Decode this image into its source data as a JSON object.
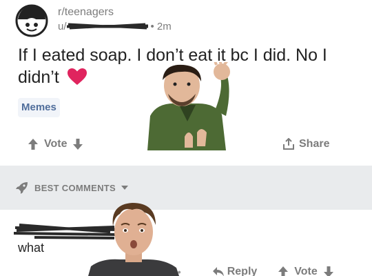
{
  "post": {
    "subreddit": "r/teenagers",
    "author": "u/",
    "time": "• 2m",
    "title": "If I eated soap. I don’t eat it bc I did. No I didn’t",
    "flair": "Memes",
    "vote_label": "Vote",
    "share_label": "Share"
  },
  "sort": {
    "label": "BEST COMMENTS"
  },
  "comment": {
    "text": "what",
    "dots": "•••",
    "reply_label": "Reply",
    "vote_label": "Vote"
  },
  "icons": {
    "avatar": "snoo-avatar-icon",
    "heart": "heart-emoji-icon",
    "upvote": "upvote-arrow-icon",
    "downvote": "downvote-arrow-icon",
    "share": "share-icon",
    "rocket": "rocket-icon",
    "reply": "reply-icon"
  },
  "colors": {
    "flair_text": "#4f6d9b",
    "sort_bar_bg": "#e9ebed",
    "heart": "#e0245e",
    "muted": "#7c7c7c"
  }
}
